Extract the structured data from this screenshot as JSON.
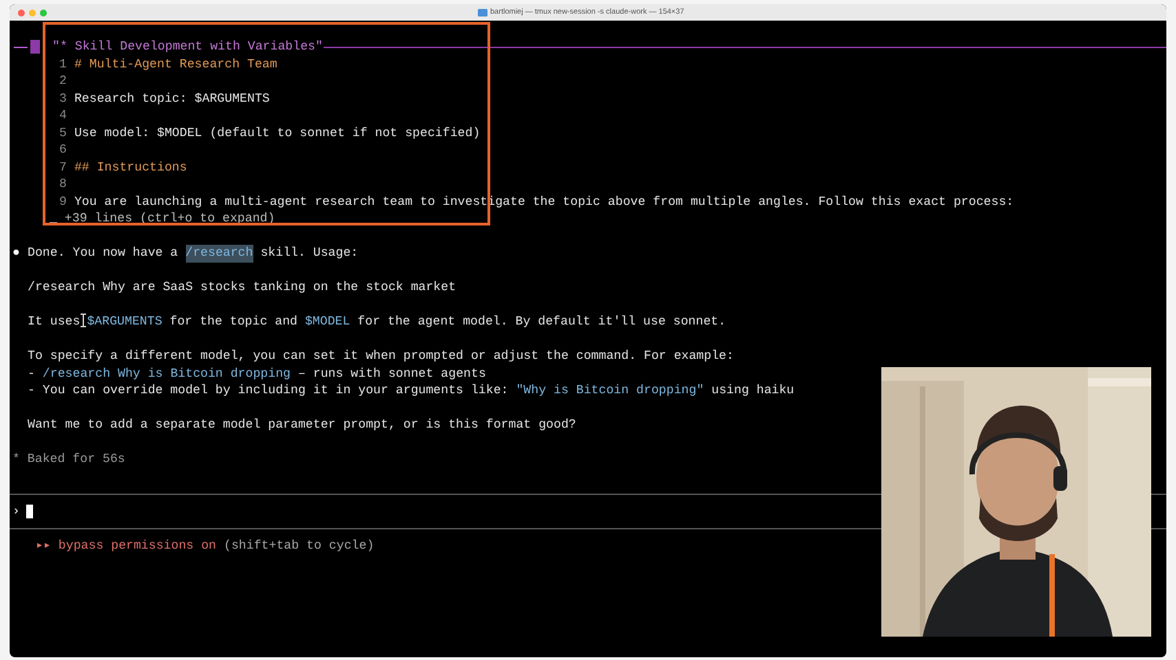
{
  "window": {
    "title": "bartlomiej — tmux new-session -s claude-work — 154×37"
  },
  "file_preview": {
    "title": "\"* Skill Development with Variables\"",
    "lines": [
      {
        "number": "1",
        "text": "# Multi-Agent Research Team",
        "kind": "heading"
      },
      {
        "number": "2",
        "kind": "blank"
      },
      {
        "number": "3",
        "text": "Research topic: $ARGUMENTS",
        "kind": "text"
      },
      {
        "number": "4",
        "kind": "blank"
      },
      {
        "number": "5",
        "text": "Use model: $MODEL (default to sonnet if not specified)",
        "kind": "text"
      },
      {
        "number": "6",
        "kind": "blank"
      },
      {
        "number": "7",
        "text": "## Instructions",
        "kind": "heading"
      },
      {
        "number": "8",
        "kind": "blank"
      },
      {
        "number": "9",
        "text": "You are launching a multi-agent research team to investigate the topic above from multiple angles. Follow this exact process:",
        "kind": "text"
      }
    ],
    "more": "_ +39 lines (ctrl+o to expand)"
  },
  "response": {
    "bullet": "●",
    "lines": [
      {
        "kind": "first",
        "spans": [
          {
            "kind": "plain",
            "text": "Done. You now have a "
          },
          {
            "kind": "highlight",
            "text": "/research"
          },
          {
            "kind": "plain",
            "text": " skill. Usage:"
          }
        ]
      },
      {
        "kind": "blank"
      },
      {
        "kind": "body",
        "spans": [
          {
            "kind": "plain",
            "text": "/research Why are SaaS stocks tanking on the stock market"
          }
        ]
      },
      {
        "kind": "blank"
      },
      {
        "kind": "body",
        "spans": [
          {
            "kind": "plain",
            "text": "It uses"
          },
          {
            "kind": "mouse_cursor"
          },
          {
            "kind": "code",
            "text": "$ARGUMENTS"
          },
          {
            "kind": "plain",
            "text": " for the topic and "
          },
          {
            "kind": "code",
            "text": "$MODEL"
          },
          {
            "kind": "plain",
            "text": " for the agent model. By default it'll use sonnet."
          }
        ]
      },
      {
        "kind": "blank"
      },
      {
        "kind": "body",
        "spans": [
          {
            "kind": "plain",
            "text": "To specify a different model, you can set it when prompted or adjust the command. For example:"
          }
        ]
      },
      {
        "kind": "body",
        "spans": [
          {
            "kind": "plain",
            "text": "- "
          },
          {
            "kind": "code",
            "text": "/research Why is Bitcoin dropping"
          },
          {
            "kind": "plain",
            "text": " – runs with sonnet agents"
          }
        ]
      },
      {
        "kind": "body",
        "spans": [
          {
            "kind": "plain",
            "text": "- You can override model by including it in your arguments like: "
          },
          {
            "kind": "code",
            "text": "\"Why is Bitcoin dropping\""
          },
          {
            "kind": "plain",
            "text": " using haiku"
          }
        ]
      },
      {
        "kind": "blank"
      },
      {
        "kind": "body",
        "spans": [
          {
            "kind": "plain",
            "text": "Want me to add a separate model parameter prompt, or is this format good?"
          }
        ]
      },
      {
        "kind": "blank"
      }
    ]
  },
  "status_line": "* Baked for 56s",
  "prompt": {
    "symbol": "›"
  },
  "mode": {
    "label": "▸▸ bypass permissions on",
    "hint": "(shift+tab to cycle)"
  }
}
